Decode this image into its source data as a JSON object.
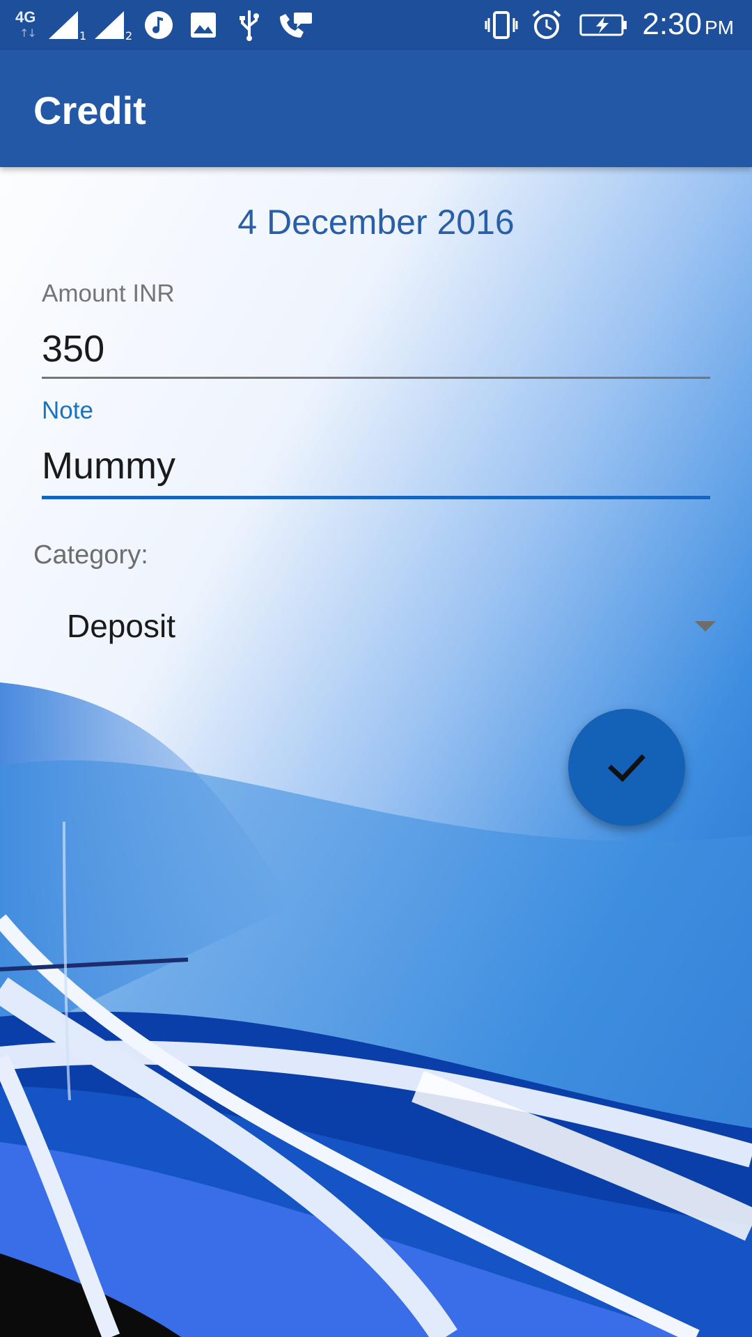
{
  "status_bar": {
    "network": "4G",
    "sim1": "1",
    "sim2": "2",
    "time": "2:30",
    "ampm": "PM",
    "icons": [
      "signal-icon",
      "music-icon",
      "image-icon",
      "usb-icon",
      "voicemail-icon",
      "vibrate-icon",
      "alarm-icon",
      "battery-charging-icon"
    ]
  },
  "app_bar": {
    "title": "Credit"
  },
  "form": {
    "date": "4 December 2016",
    "amount": {
      "label": "Amount INR",
      "value": "350"
    },
    "note": {
      "label": "Note",
      "value": "Mummy"
    },
    "category": {
      "label": "Category:",
      "selected": "Deposit"
    }
  },
  "fab": {
    "icon": "check-icon"
  },
  "colors": {
    "status_bar": "#1e4f9a",
    "app_bar": "#2258a6",
    "accent": "#1565c0",
    "date_text": "#2a5fa8"
  }
}
